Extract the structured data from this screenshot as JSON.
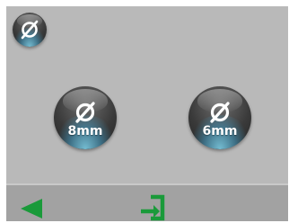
{
  "toolbar": {
    "diameter_button": {
      "icon": "diameter-icon"
    }
  },
  "size_options": [
    {
      "label": "8mm",
      "icon": "diameter-icon"
    },
    {
      "label": "6mm",
      "icon": "diameter-icon"
    }
  ],
  "bottom_bar": {
    "back_icon": "back-arrow-icon",
    "exit_icon": "exit-icon",
    "accent_color": "#1a9a3a"
  },
  "colors": {
    "screen_background": "#b9b9b9",
    "bottom_bar_background": "#a2a2a2",
    "button_glow": "#82d7f0"
  }
}
